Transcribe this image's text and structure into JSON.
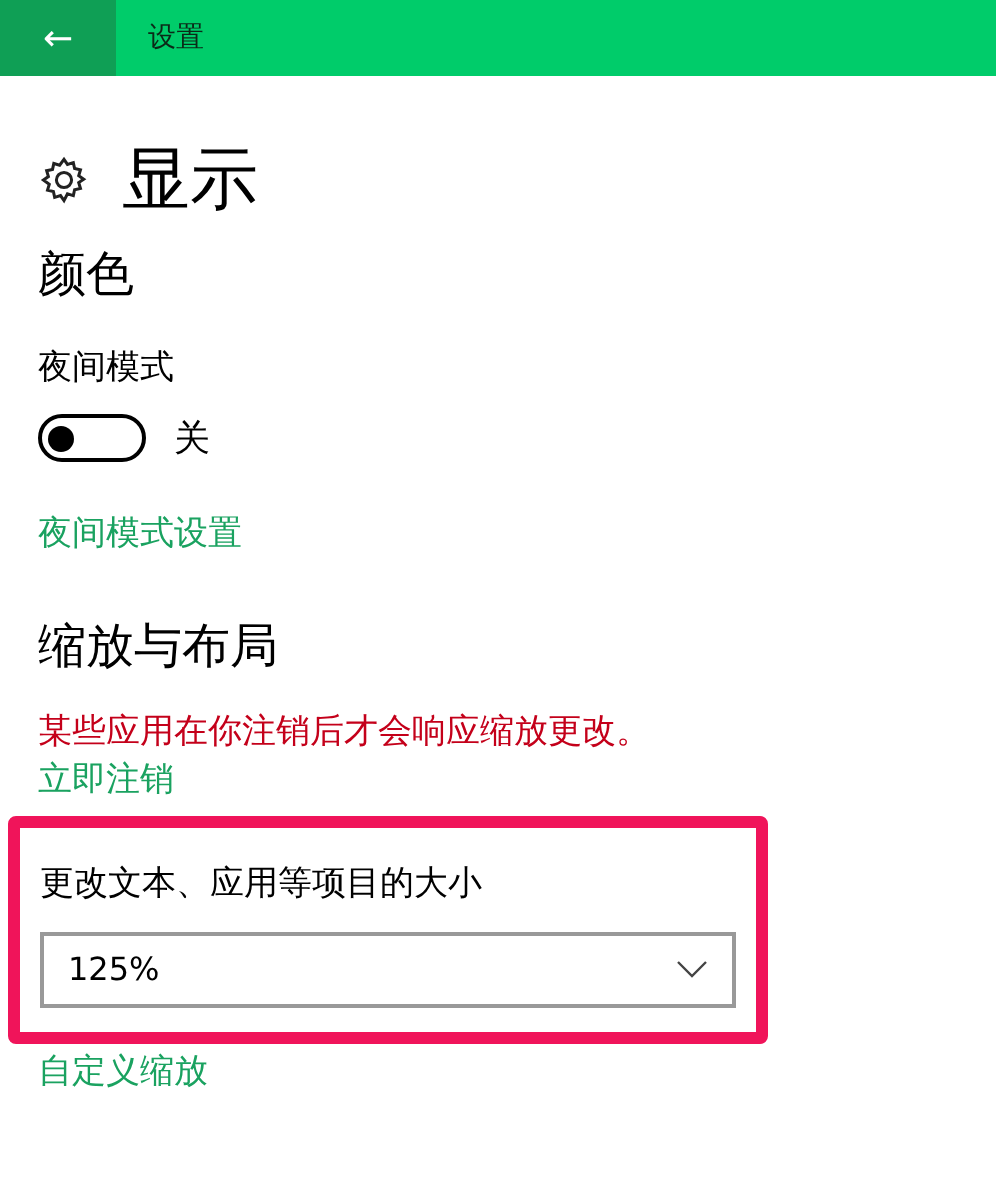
{
  "header": {
    "back_icon": "←",
    "title": "设置"
  },
  "page": {
    "title": "显示"
  },
  "color_section": {
    "heading": "颜色",
    "night_mode": {
      "label": "夜间模式",
      "on": false,
      "state_text": "关"
    },
    "link": "夜间模式设置"
  },
  "scale_section": {
    "heading": "缩放与布局",
    "warning": "某些应用在你注销后才会响应缩放更改。",
    "signout_link": "立即注销",
    "highlighted": true,
    "size_label": "更改文本、应用等项目的大小",
    "size_value": "125%",
    "custom_link": "自定义缩放"
  }
}
